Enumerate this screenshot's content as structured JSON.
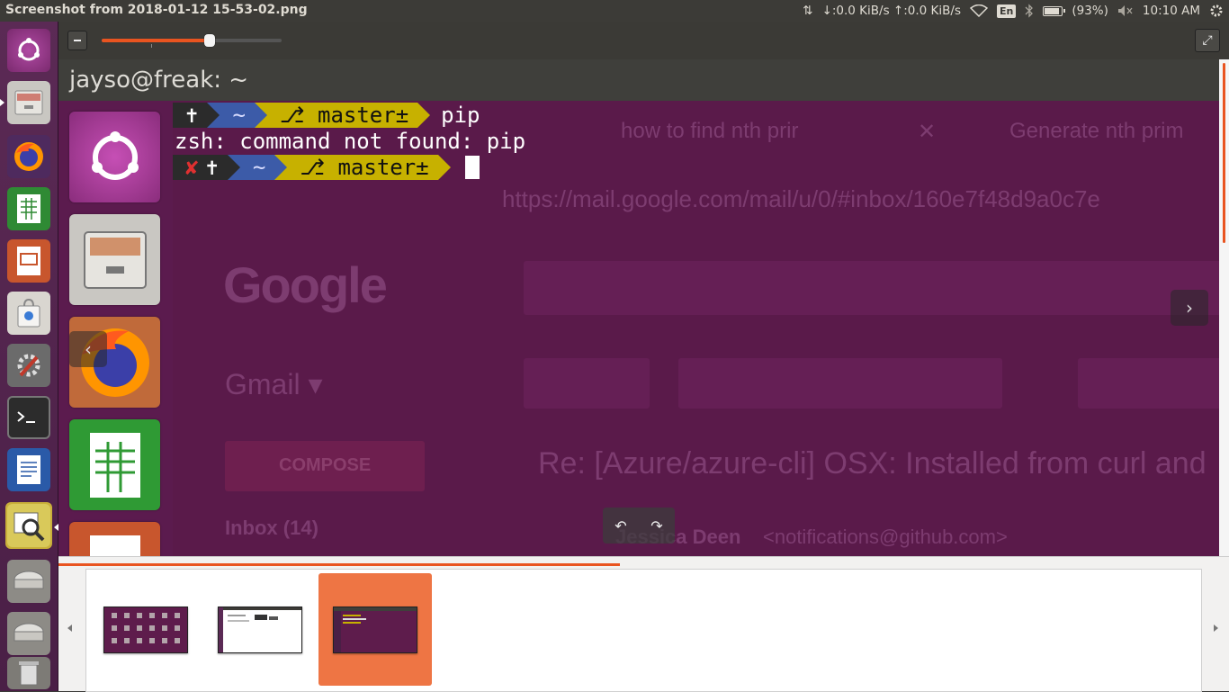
{
  "window": {
    "title": "Screenshot from 2018-01-12 15-53-02.png"
  },
  "indicators": {
    "network_speed": "↓:0.0 KiB/s ↑:0.0 KiB/s",
    "keyboard": "En",
    "battery": "(93%)",
    "battery_level": 0.93,
    "time": "10:10 AM"
  },
  "launcher": {
    "items": [
      "ubuntu-dash",
      "files",
      "firefox",
      "libreoffice-calc",
      "libreoffice-impress",
      "ubuntu-software",
      "system-settings",
      "terminal",
      "libreoffice-writer",
      "image-viewer",
      "drive",
      "drive",
      "trash"
    ]
  },
  "viewer": {
    "zoom_level": 0.6
  },
  "screenshot": {
    "terminal_title": "jayso@freak: ~",
    "line1": {
      "seg1": "✝",
      "seg2": "~",
      "seg3": "⎇ master±",
      "command": "pip"
    },
    "line2": "zsh: command not found: pip",
    "line3": {
      "seg0": "✘",
      "seg1": "✝",
      "seg2": "~",
      "seg3": "⎇ master±"
    },
    "ghost": {
      "tab1": "how to find nth prir",
      "tab_close": "✕",
      "tab2": "Generate nth prim",
      "url": "https://mail.google.com/mail/u/0/#inbox/160e7f48d9a0c7e",
      "logo": "Google",
      "gmail": "Gmail ▾",
      "compose": "COMPOSE",
      "subject": "Re: [Azure/azure-cli] OSX: Installed from curl and",
      "inbox": "Inbox (14)",
      "sender": "Jessica Deen",
      "sender_email": "<notifications@github.com>"
    },
    "nav_prev": "‹",
    "nav_next": "›",
    "rotate_left": "↶",
    "rotate_right": "↷"
  },
  "gallery": {
    "progress": 0.48,
    "thumbnails": [
      {
        "kind": "app-grid",
        "selected": false
      },
      {
        "kind": "document",
        "selected": false
      },
      {
        "kind": "terminal",
        "selected": true
      }
    ]
  },
  "colors": {
    "accent": "#e95420",
    "launcher_bg": "#5b2a55",
    "terminal_bg": "#5e1c4c",
    "selected_thumb": "#ee7544"
  }
}
